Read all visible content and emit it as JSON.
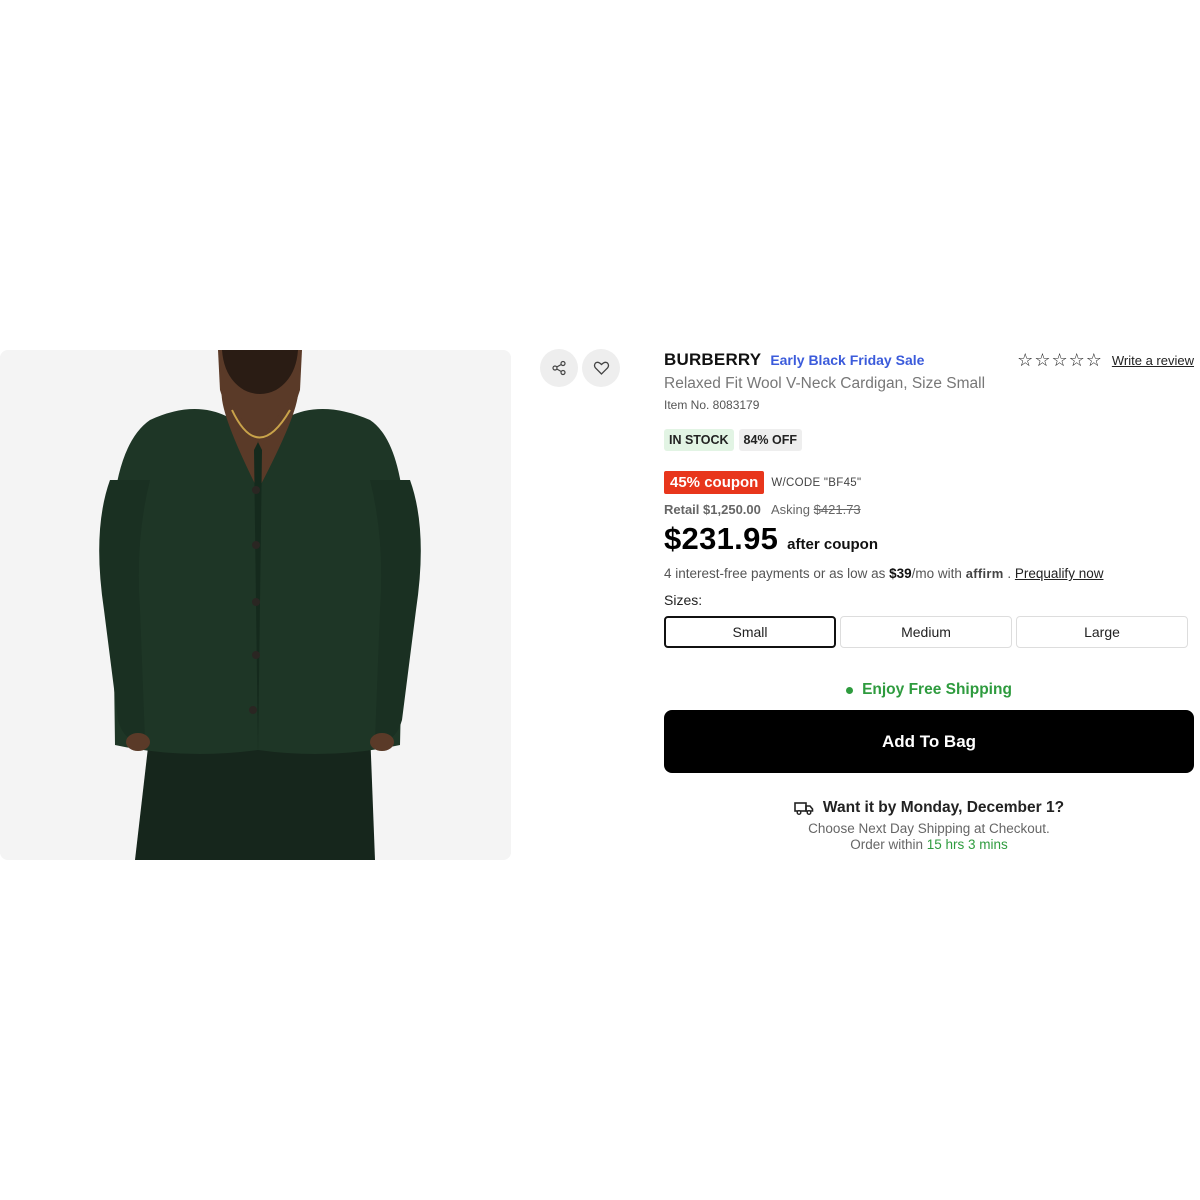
{
  "product": {
    "brand": "BURBERRY",
    "sale_label": "Early Black Friday Sale",
    "title": "Relaxed Fit Wool V-Neck Cardigan, Size Small",
    "item_no": "Item No. 8083179",
    "rating": 0,
    "write_review": "Write a review",
    "image_alt": "Green wool v-neck cardigan worn by model"
  },
  "badges": {
    "stock": "IN STOCK",
    "discount": "84% OFF"
  },
  "coupon": {
    "label": "45% coupon",
    "code": "W/CODE \"BF45\""
  },
  "pricing": {
    "retail_label": "Retail",
    "retail_value": "$1,250.00",
    "asking_label": "Asking",
    "asking_value": "$421.73",
    "price": "$231.95",
    "after_coupon": "after coupon"
  },
  "affirm": {
    "prefix": "4 interest-free payments or as low as",
    "amount": "$39",
    "per": "/mo with",
    "brand": "affirm",
    "sep": ".",
    "prequalify": "Prequalify now"
  },
  "sizes": {
    "label": "Sizes:",
    "options": [
      "Small",
      "Medium",
      "Large"
    ],
    "selected": "Small"
  },
  "shipping": {
    "free": "Enjoy Free Shipping"
  },
  "cta": {
    "add_to_bag": "Add To Bag"
  },
  "delivery": {
    "headline": "Want it by Monday, December 1?",
    "choose": "Choose Next Day Shipping at Checkout.",
    "order_prefix": "Order within",
    "order_time": "15 hrs 3 mins"
  },
  "colors": {
    "sale_blue": "#3b5bdb",
    "coupon_red": "#e8361c",
    "success_green": "#2e9b3e",
    "cardigan_green": "#1f3a2a"
  },
  "icons": {
    "share": "share-icon",
    "favorite": "heart-icon",
    "truck": "truck-icon",
    "star": "star-outline-icon"
  }
}
